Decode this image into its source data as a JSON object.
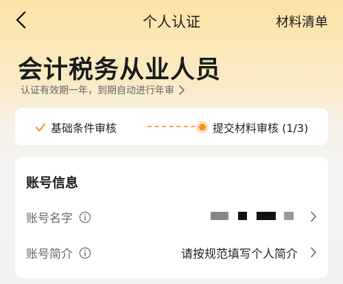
{
  "nav": {
    "title": "个人认证",
    "right_action": "材料清单"
  },
  "header": {
    "role_title": "会计税务从业人员",
    "subline": "认证有效期一年，到期自动进行年审"
  },
  "progress": {
    "step1_label": "基础条件审核",
    "step2_label": "提交材料审核 (1/3)",
    "accent_color": "#F7931E"
  },
  "account": {
    "section_title": "账号信息",
    "rows": [
      {
        "label": "账号名字",
        "value": ""
      },
      {
        "label": "账号简介",
        "value": "请按规范填写个人简介"
      }
    ]
  }
}
